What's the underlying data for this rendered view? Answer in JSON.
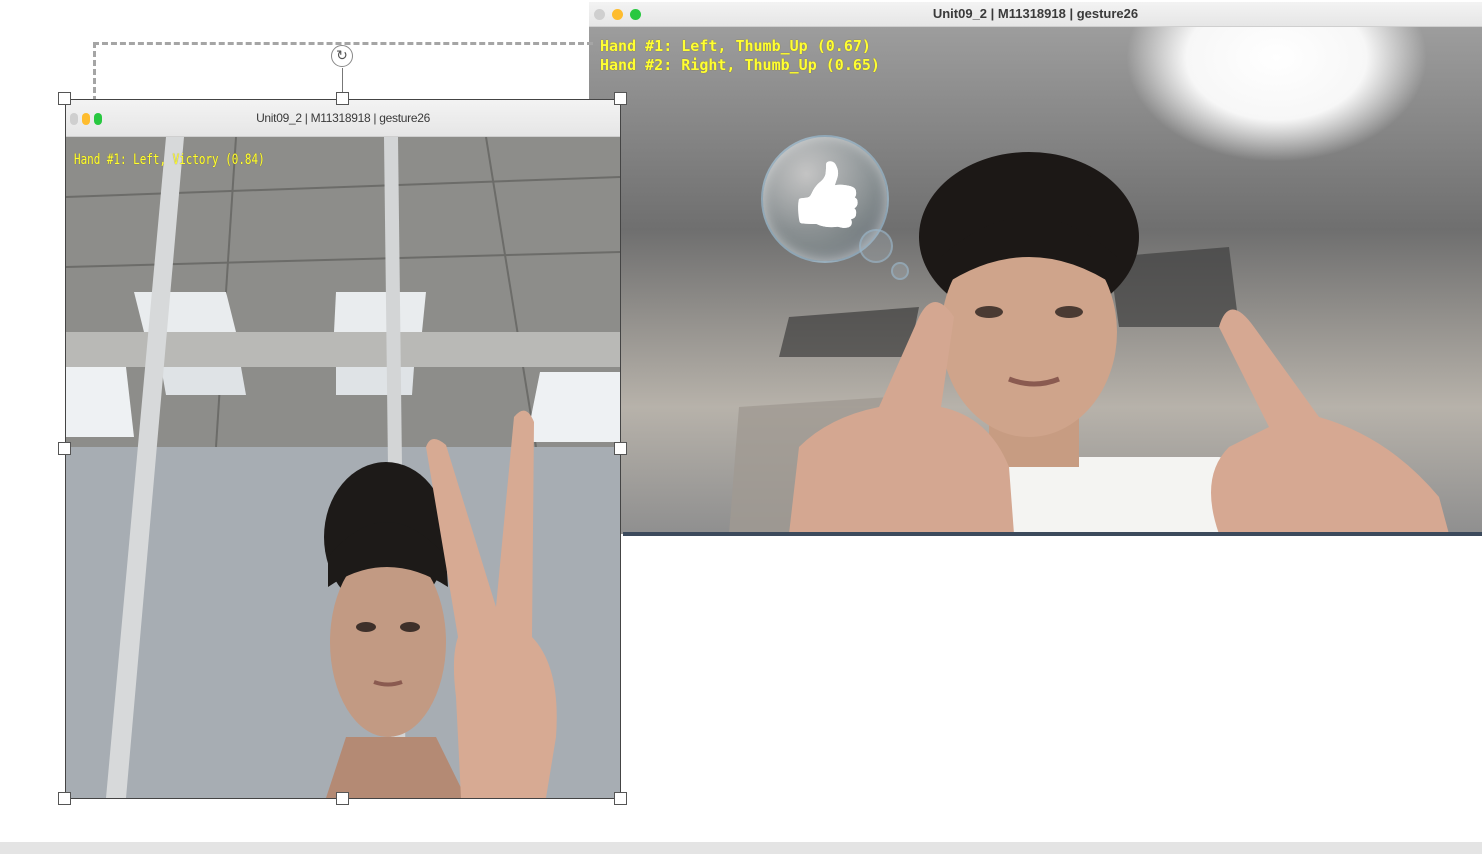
{
  "window_main": {
    "title": "Unit09_2 | M11318918 | gesture26",
    "overlay_lines": [
      "Hand #1: Left, Thumb_Up (0.67)",
      "Hand #2: Right, Thumb_Up (0.65)"
    ],
    "emoji": "👍"
  },
  "window_small": {
    "title": "Unit09_2 | M11318918 | gesture26",
    "overlay_lines": [
      "Hand #1: Left, Victory (0.84)"
    ]
  },
  "colors": {
    "overlay_text": "#ffff33",
    "traffic_close": "#ff5f57",
    "traffic_min": "#febc2e",
    "traffic_max": "#28c840",
    "traffic_inactive": "#cfcfcf"
  },
  "icons": {
    "rotate_handle": "rotate-icon",
    "bubble": "thumbs-up-icon"
  }
}
